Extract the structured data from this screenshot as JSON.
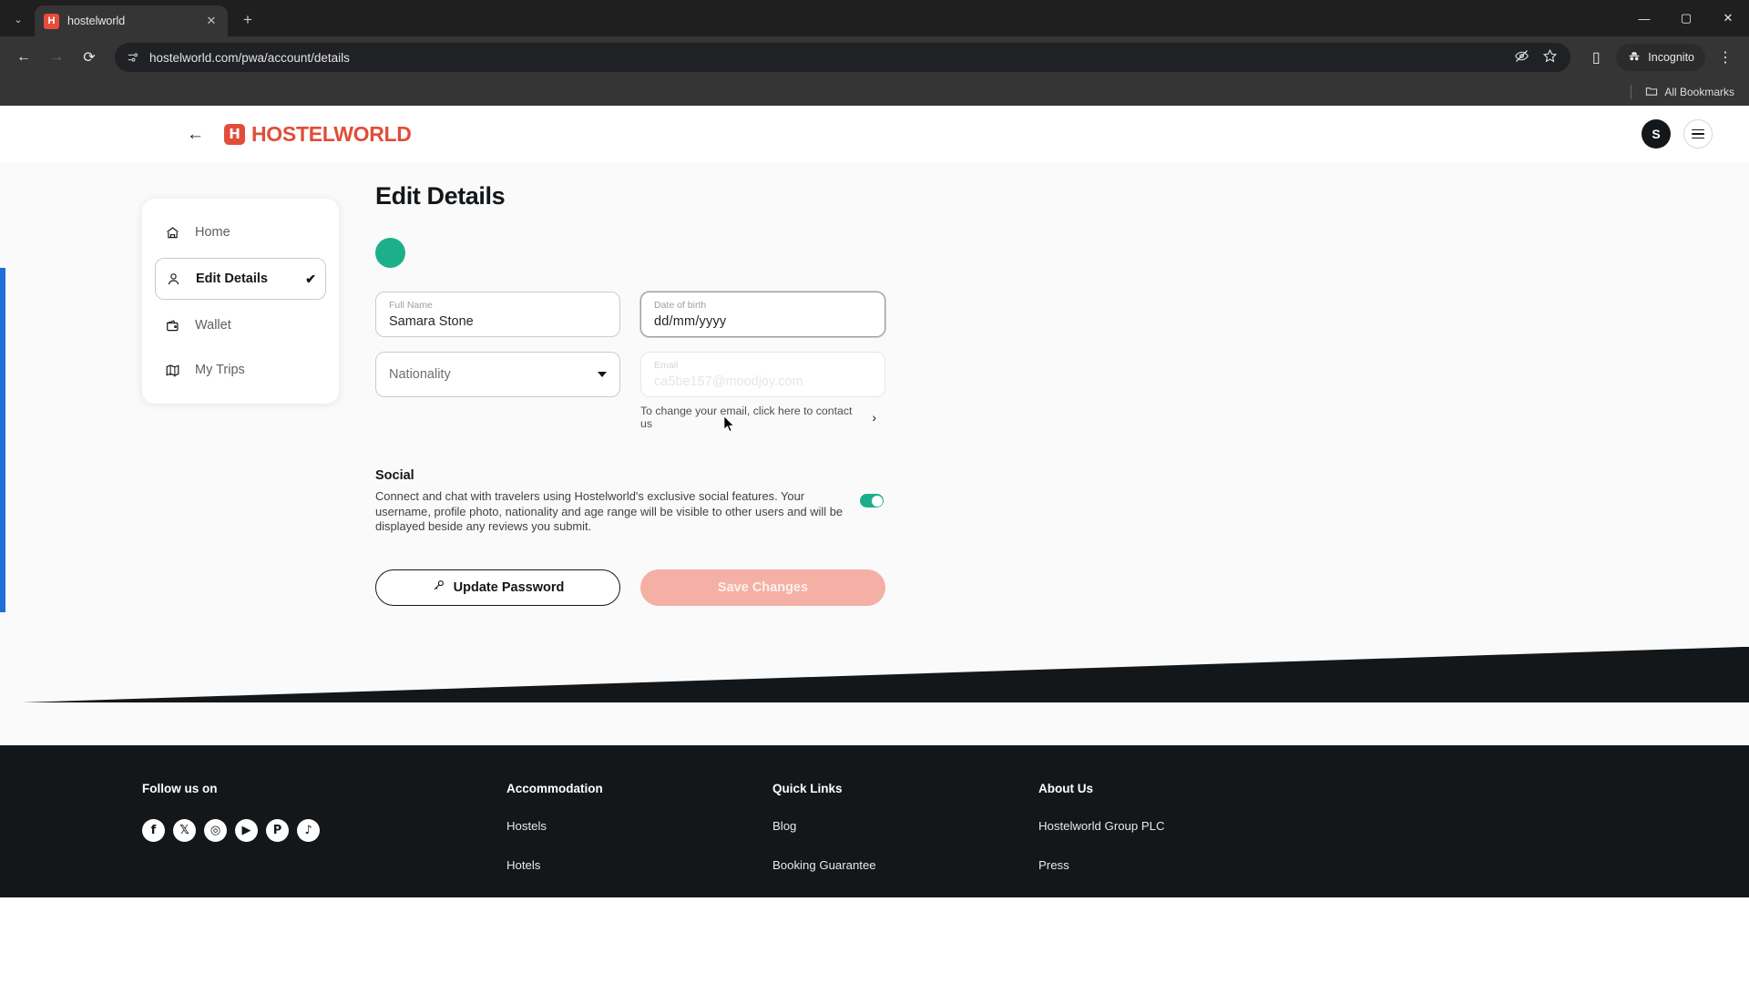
{
  "browser": {
    "tab": {
      "title": "hostelworld",
      "favicon_letter": "H",
      "favicon_name": "hostelworld-favicon"
    },
    "new_tab_label": "+",
    "tab_search_label": "⌄",
    "close_label": "✕",
    "nav": {
      "back": "←",
      "forward": "→",
      "reload": "⟳"
    },
    "omnibox": {
      "url": "hostelworld.com/pwa/account/details",
      "site_info_icon": "site-settings-icon"
    },
    "omni_right": {
      "tracking_icon": "eye-slash-icon",
      "bookmark_icon": "star-icon"
    },
    "side_panel_label": "▯",
    "incognito": {
      "label": "Incognito",
      "icon": "incognito-hat-icon"
    },
    "menu_label": "⋮",
    "window": {
      "minimize": "—",
      "maximize": "▢",
      "close": "✕"
    },
    "bookmarks": {
      "all_bookmarks_label": "All Bookmarks",
      "folder_icon": "folder-icon"
    }
  },
  "header": {
    "back_arrow": "←",
    "logo": {
      "mark": "H",
      "word": "HOSTELWORLD"
    },
    "avatar_initial": "S",
    "menu_icon": "hamburger-icon"
  },
  "sidebar": {
    "items": [
      {
        "label": "Home",
        "icon": "home-icon",
        "active": false
      },
      {
        "label": "Edit Details",
        "icon": "user-icon",
        "active": true,
        "check": "✔"
      },
      {
        "label": "Wallet",
        "icon": "wallet-icon",
        "active": false
      },
      {
        "label": "My Trips",
        "icon": "map-icon",
        "active": false
      }
    ]
  },
  "main": {
    "title": "Edit Details",
    "avatar_color": "#1cb08a",
    "fields": {
      "full_name": {
        "label": "Full Name",
        "value": "Samara Stone"
      },
      "date_of_birth": {
        "label": "Date of birth",
        "value": "dd/mm/yyyy"
      },
      "nationality": {
        "label": "Nationality",
        "value": "Nationality"
      },
      "email": {
        "label": "Email",
        "value": "ca5be157@moodjoy.com"
      }
    },
    "email_note": {
      "text": "To change your email, click here to contact us",
      "chevron": "›"
    },
    "social": {
      "title": "Social",
      "description": "Connect and chat with travelers using Hostelworld's exclusive social features. Your username, profile photo, nationality and age range will be visible to other users and will be displayed beside any reviews you submit.",
      "toggle_on": true,
      "toggle_color": "#1cb08a"
    },
    "buttons": {
      "update_password": {
        "label": "Update Password",
        "icon": "key-icon"
      },
      "save_changes": {
        "label": "Save Changes",
        "disabled": true,
        "color": "#f4b0a4"
      }
    }
  },
  "footer": {
    "columns": [
      {
        "heading": "Follow us on",
        "socials": [
          {
            "name": "facebook-icon",
            "glyph": "f"
          },
          {
            "name": "x-twitter-icon",
            "glyph": "𝕏"
          },
          {
            "name": "instagram-icon",
            "glyph": "◎"
          },
          {
            "name": "youtube-icon",
            "glyph": "▶"
          },
          {
            "name": "pinterest-icon",
            "glyph": "P"
          },
          {
            "name": "tiktok-icon",
            "glyph": "♪"
          }
        ]
      },
      {
        "heading": "Accommodation",
        "links": [
          "Hostels",
          "Hotels"
        ]
      },
      {
        "heading": "Quick Links",
        "links": [
          "Blog",
          "Booking Guarantee"
        ]
      },
      {
        "heading": "About Us",
        "links": [
          "Hostelworld Group PLC",
          "Press"
        ]
      }
    ]
  }
}
